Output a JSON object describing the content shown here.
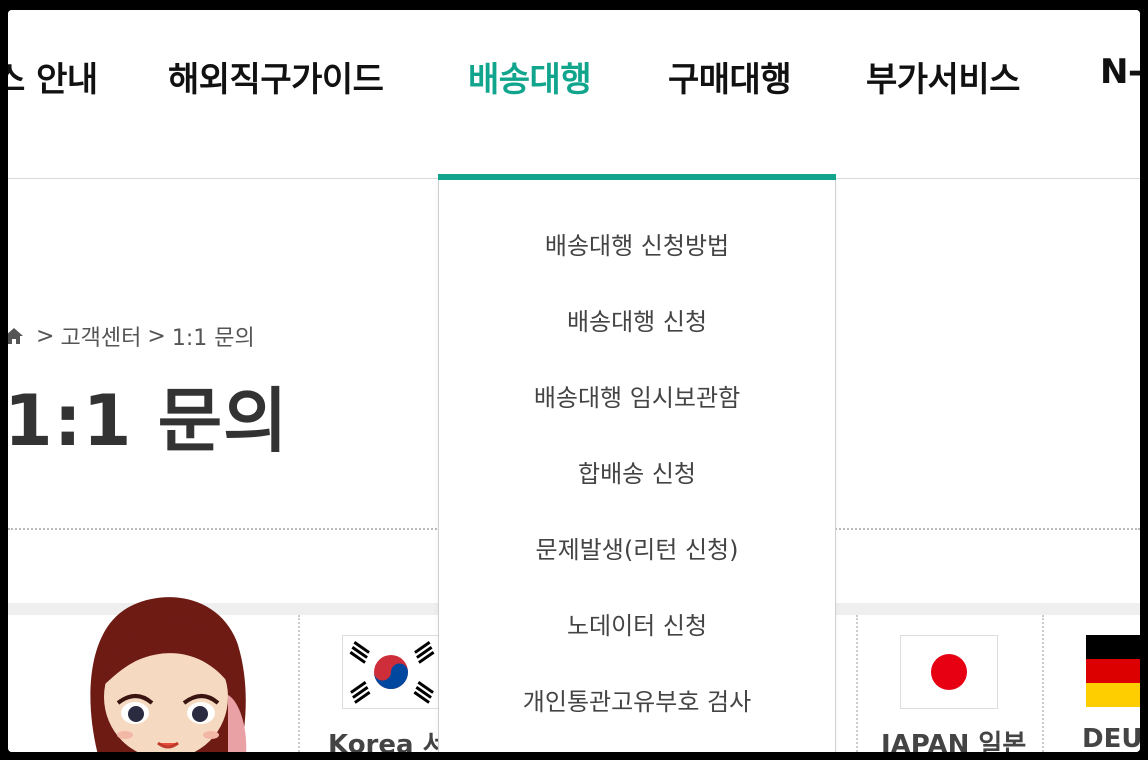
{
  "nav": {
    "items": [
      {
        "label": "스 안내"
      },
      {
        "label": "해외직구가이드"
      },
      {
        "label": "배송대행"
      },
      {
        "label": "구매대행"
      },
      {
        "label": "부가서비스"
      },
      {
        "label": "N-"
      }
    ],
    "active_color": "#12a58e"
  },
  "dropdown": {
    "items": [
      {
        "label": "배송대행 신청방법"
      },
      {
        "label": "배송대행 신청"
      },
      {
        "label": "배송대행 임시보관함"
      },
      {
        "label": "합배송 신청"
      },
      {
        "label": "문제발생(리턴 신청)"
      },
      {
        "label": "노데이터 신청"
      },
      {
        "label": "개인통관고유부호 검사"
      }
    ]
  },
  "breadcrumb": {
    "sep1": ">",
    "customer_center": "고객센터",
    "sep2": ">",
    "current": "1:1 문의"
  },
  "page": {
    "title": "1:1 문의"
  },
  "cards": {
    "korea_label": "Korea 서",
    "japan_label": "JAPAN 일본",
    "germany_label": "DEU"
  },
  "icons": {
    "home": "home-icon",
    "korea_flag": "korea-flag-icon",
    "japan_flag": "japan-flag-icon",
    "germany_flag": "germany-flag-icon"
  }
}
